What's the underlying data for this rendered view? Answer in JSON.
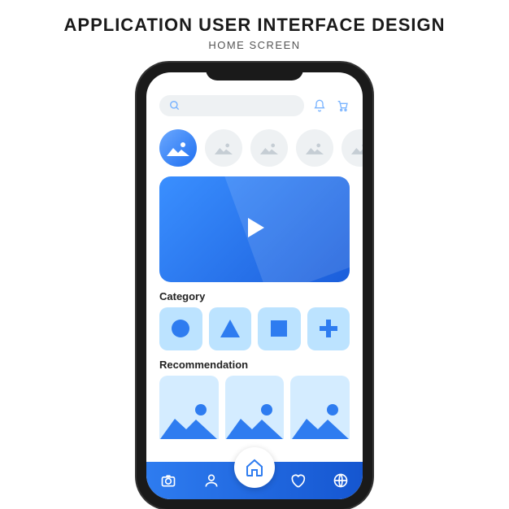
{
  "header": {
    "title": "APPLICATION USER INTERFACE DESIGN",
    "subtitle": "HOME SCREEN"
  },
  "sections": {
    "category": "Category",
    "recommendation": "Recommendation"
  },
  "colors": {
    "accent": "#2e7cf0",
    "accent_light": "#bce3ff"
  }
}
